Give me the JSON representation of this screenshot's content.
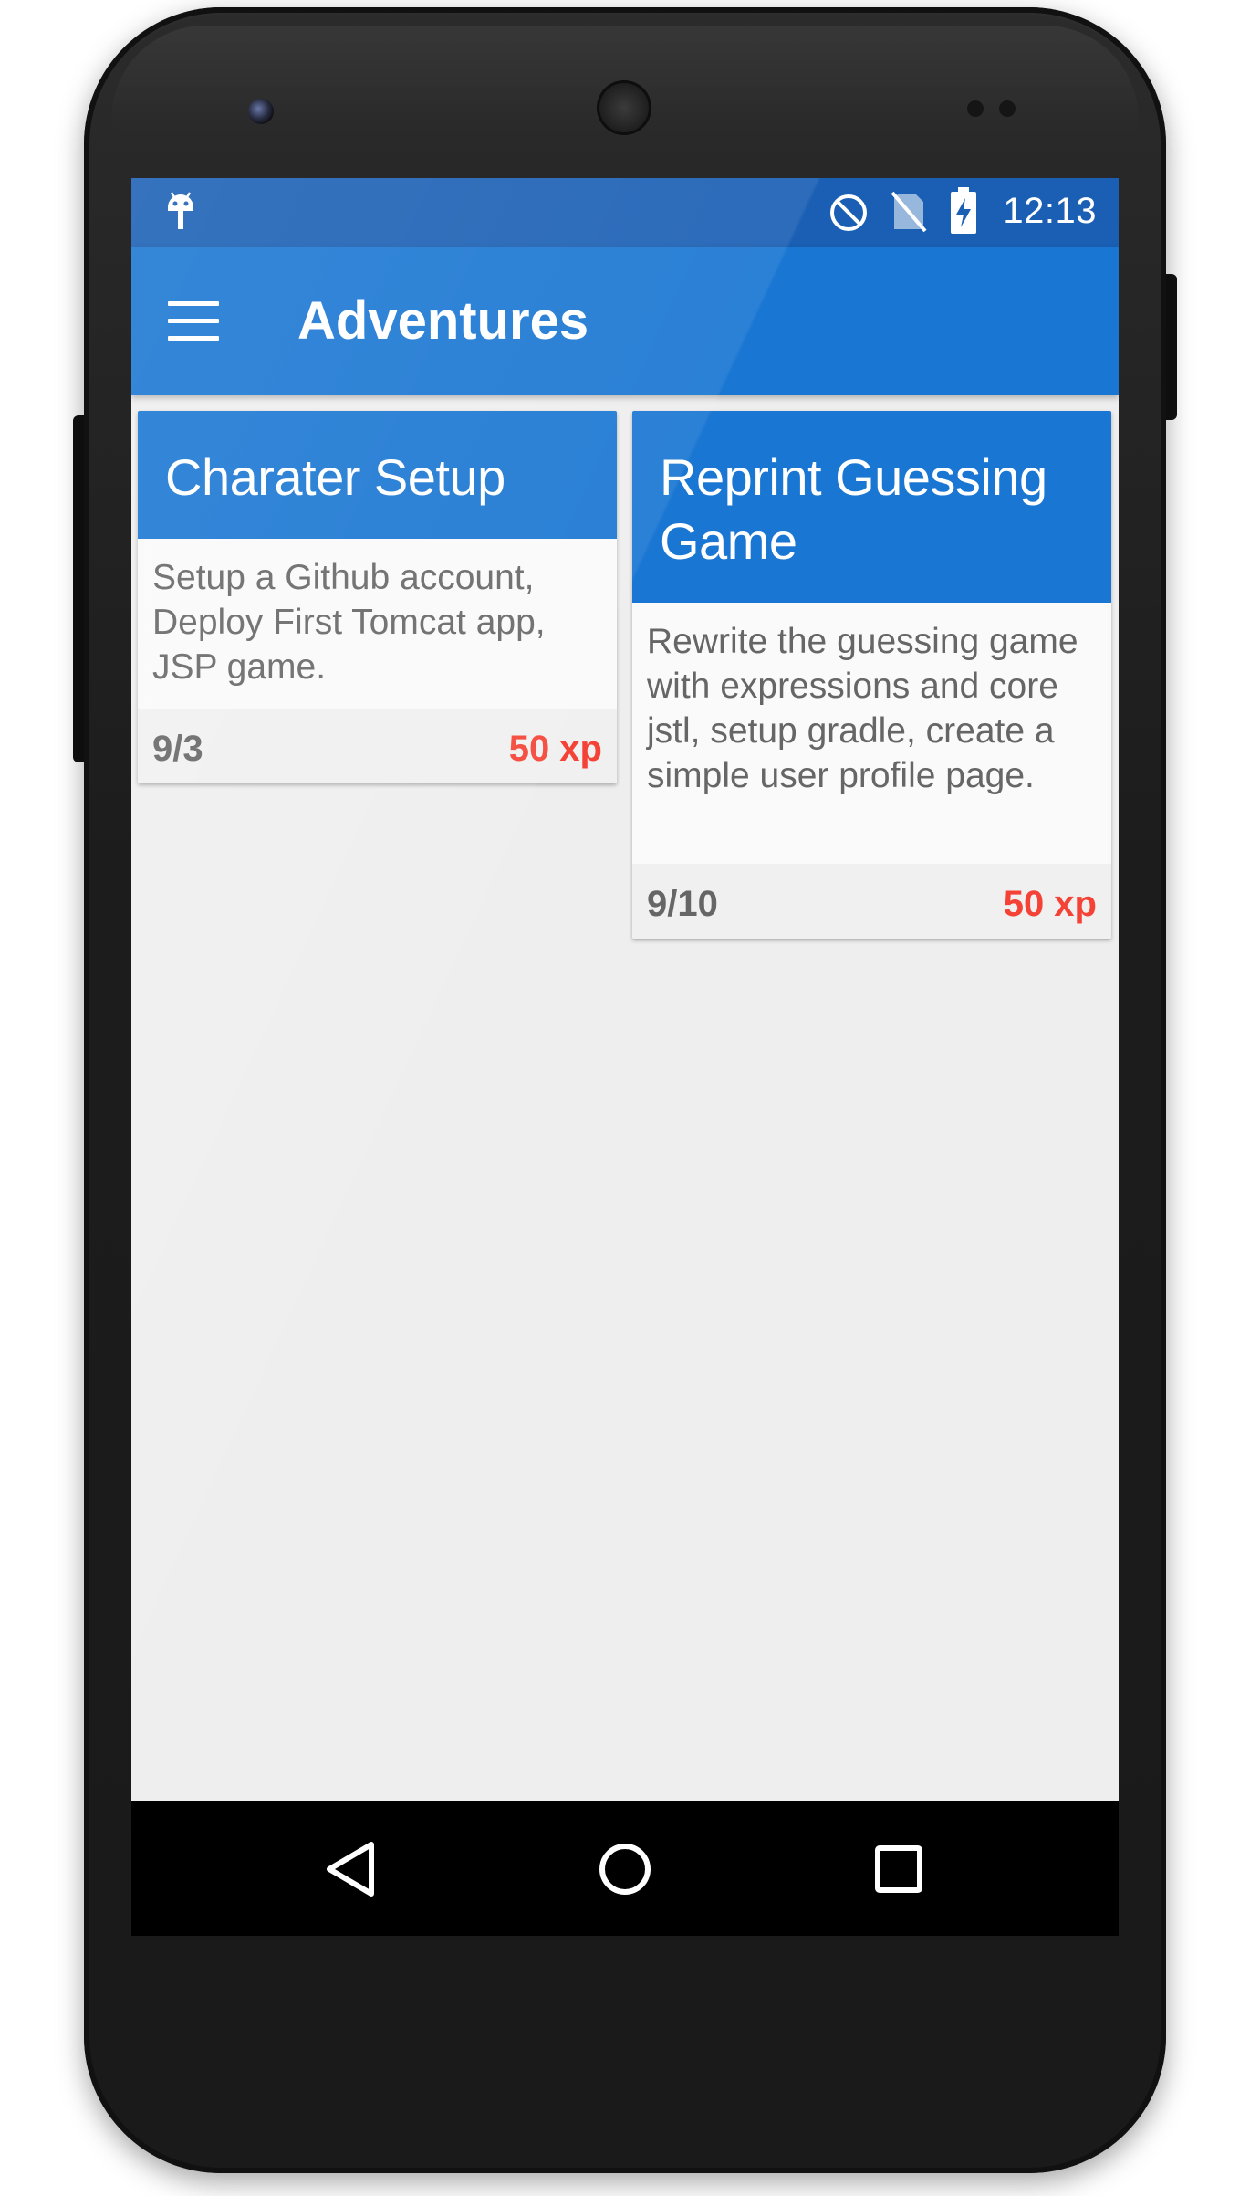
{
  "status_bar": {
    "time": "12:13",
    "icons": [
      "android-debug-icon",
      "do-not-disturb-icon",
      "no-sim-icon",
      "battery-charging-icon"
    ]
  },
  "app_bar": {
    "title": "Adventures",
    "menu_icon": "menu-icon"
  },
  "cards": [
    {
      "title": "Charater Setup",
      "description": "Setup a Github account, Deploy First Tomcat app, JSP game.",
      "date": "9/3",
      "xp": "50 xp"
    },
    {
      "title": "Reprint Guessing Game",
      "description": "Rewrite the guessing game with expressions and core jstl, setup gradle, create a simple user profile page.",
      "date": "9/10",
      "xp": "50 xp"
    }
  ],
  "nav_bar": {
    "buttons": [
      "back-icon",
      "home-icon",
      "recents-icon"
    ]
  },
  "colors": {
    "primary": "#1976d2",
    "primary_dark": "#1a5fb4",
    "background": "#eeeeee",
    "xp_accent": "#f44336",
    "secondary_text": "#666666"
  }
}
